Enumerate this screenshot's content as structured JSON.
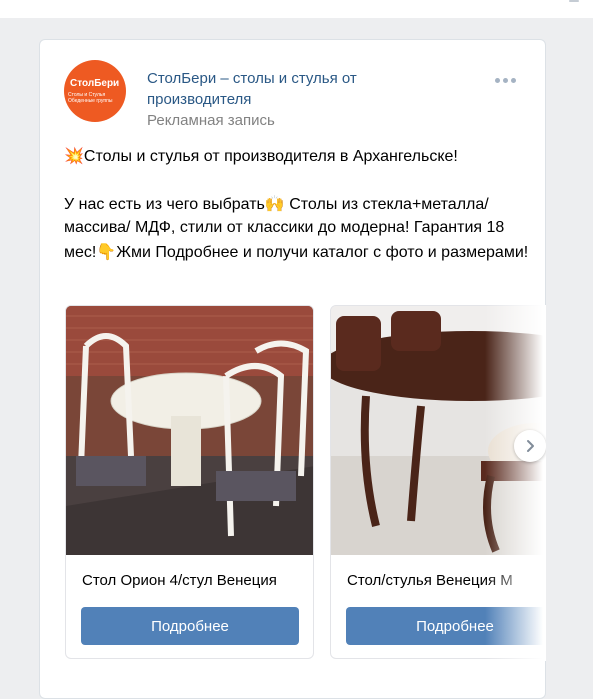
{
  "post": {
    "author": "СтолБери – столы и стулья от производителя",
    "subtitle": "Рекламная запись",
    "avatar": {
      "line1": "СтолБери",
      "line2": "Столы и Стулья",
      "line3": "Обеденные группы"
    },
    "text": {
      "line1": "Столы и стулья от производителя в Архангельске!",
      "line2a": "У нас есть из чего выбрать",
      "line2b": " Столы из стекла+металла/ массива/ МДФ, стили от классики до модерна! Гарантия 18 мес!",
      "line2c": "Жми Подробнее и получи каталог с фото и размерами!"
    },
    "emoji": {
      "boom": "💥",
      "hands": "🙌",
      "point": "👇"
    }
  },
  "carousel": {
    "cards": [
      {
        "title": "Стол Орион 4/стул Венеция",
        "button": "Подробнее"
      },
      {
        "title": "Стол/стулья Венеция М",
        "button": "Подробнее"
      }
    ]
  },
  "colors": {
    "link": "#2a5885",
    "button": "#5181b8",
    "avatar": "#ee5a22"
  },
  "icons": {
    "more": "more-horizontal-icon",
    "next": "chevron-right-icon"
  }
}
